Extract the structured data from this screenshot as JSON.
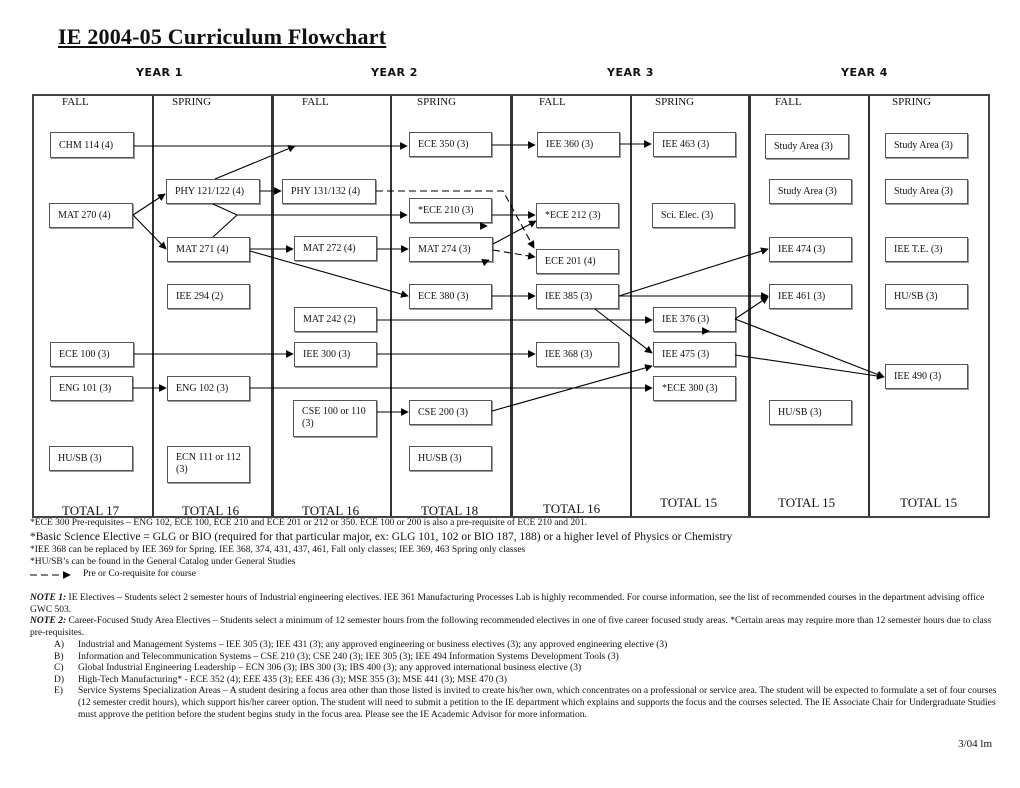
{
  "title": "IE 2004-05 Curriculum Flowchart",
  "years": [
    "YEAR 1",
    "YEAR 2",
    "YEAR 3",
    "YEAR 4"
  ],
  "semesters": [
    "FALL",
    "SPRING",
    "FALL",
    "SPRING",
    "FALL",
    "SPRING",
    "FALL",
    "SPRING"
  ],
  "totals": [
    "TOTAL  17",
    "TOTAL  16",
    "TOTAL  16",
    "TOTAL  18",
    "TOTAL 16",
    "TOTAL  15",
    "TOTAL   15",
    "TOTAL  15"
  ],
  "courses": {
    "chm114": "CHM 114 (4)",
    "mat270": "MAT 270  (4)",
    "ece100": "ECE 100  (3)",
    "eng101": "ENG 101  (3)",
    "husb_y1f": "HU/SB   (3)",
    "phy121": "PHY 121/122 (4)",
    "mat271": "MAT 271  (4)",
    "iee294": "IEE 294  (2)",
    "eng102": "ENG 102  (3)",
    "ecn111": "ECN 111 or 112  (3)",
    "phy131": "PHY 131/132 (4)",
    "mat272": "MAT 272  (4)",
    "mat242": "MAT 242  (2)",
    "iee300": "IEE 300   (3)",
    "cse100": "CSE 100 or 110   (3)",
    "ece350": "ECE 350   (3)",
    "ece210": "*ECE 210  (3)",
    "mat274": "MAT 274  (3)",
    "ece380": "ECE 380   (3)",
    "cse200": "CSE 200  (3)",
    "husb_y2s": "HU/SB   (3)",
    "iee360": "IEE 360  (3)",
    "ece212": "*ECE 212  (3)",
    "ece201": "ECE 201  (4)",
    "iee385": "IEE 385   (3)",
    "iee368": "IEE 368  (3)",
    "iee463": "IEE 463   (3)",
    "scielec": "Sci. Elec.  (3)",
    "iee376": "IEE 376   (3)",
    "iee475": "IEE 475   (3)",
    "ece300": "*ECE 300 (3)",
    "study1": "Study Area (3)",
    "study2": "Study Area (3)",
    "iee474": "IEE 474   (3)",
    "iee461": "IEE 461   (3)",
    "husb_y4f": "HU/SB   (3)",
    "study3": "Study Area (3)",
    "study4": "Study Area (3)",
    "ieete": "IEE  T.E.  (3)",
    "husb_y4s": "HU/SB  (3)",
    "iee490": "IEE 490  (3)"
  },
  "footnotes": [
    "*ECE 300 Pre-requisites – ENG 102, ECE 100, ECE 210 and ECE 201 or 212 or 350.  ECE 100 or 200 is also a pre-requisite of ECE 210 and 201.",
    "*Basic Science Elective = GLG or BIO (required for that particular major, ex: GLG 101, 102 or BIO 187, 188)  or a higher level of Physics or Chemistry",
    "*IEE 368 can be replaced by IEE 369 for Spring.  IEE 368, 374, 431, 437, 461,  Fall only classes; IEE 369, 463 Spring only classes",
    "*HU/SB’s can be found in the General Catalog under General Studies"
  ],
  "legend": {
    "label": "Pre or Co-requisite for course",
    "icon": "dashed-arrow-icon"
  },
  "note1": {
    "label": "NOTE 1:",
    "text": " IE Electives – Students select 2 semester hours of Industrial engineering electives.  IEE 361 Manufacturing Processes Lab is highly recommended. For course information, see the list of recommended courses in the department advising office GWC 503."
  },
  "note2": {
    "label": "NOTE 2:",
    "text": "  Career-Focused Study Area Electives – Students select a minimum of 12 semester hours from the following recommended electives in one of five career focused study areas.  *Certain areas may require more than 12 semester hours due to class pre-requisites."
  },
  "study_areas": [
    {
      "label": "A)",
      "text": "Industrial and Management Systems – IEE 305 (3); IEE 431 (3); any approved engineering or business electives (3); any approved engineering elective (3)"
    },
    {
      "label": "B)",
      "text": "Information and Telecommunication Systems – CSE 210 (3); CSE 240 (3); IEE 305 (3); IEE 494 Information Systems Development Tools (3)"
    },
    {
      "label": "C)",
      "text": "Global Industrial Engineering Leadership – ECN 306 (3); IBS 300 (3); IBS 400 (3); any approved international business elective (3)"
    },
    {
      "label": "D)",
      "text": "High-Tech Manufacturing* - ECE 352 (4); EEE 435 (3); EEE 436 (3); MSE 355 (3); MSE 441 (3); MSE 470 (3)"
    },
    {
      "label": "E)",
      "text": "Service Systems Specialization Areas – A student desiring a focus area other than those listed is invited to create his/her own, which concentrates on a professional or service area.  The student will be expected to formulate a set of four courses (12 semester credit hours), which support his/her career option.  The student will need to submit a petition to the IE department which explains and supports the focus and the courses selected.  The IE Associate Chair for Undergraduate Studies must approve the petition before the student begins study in the focus area.  Please see the IE Academic Advisor for more information."
    }
  ],
  "footer": "3/04 lm"
}
